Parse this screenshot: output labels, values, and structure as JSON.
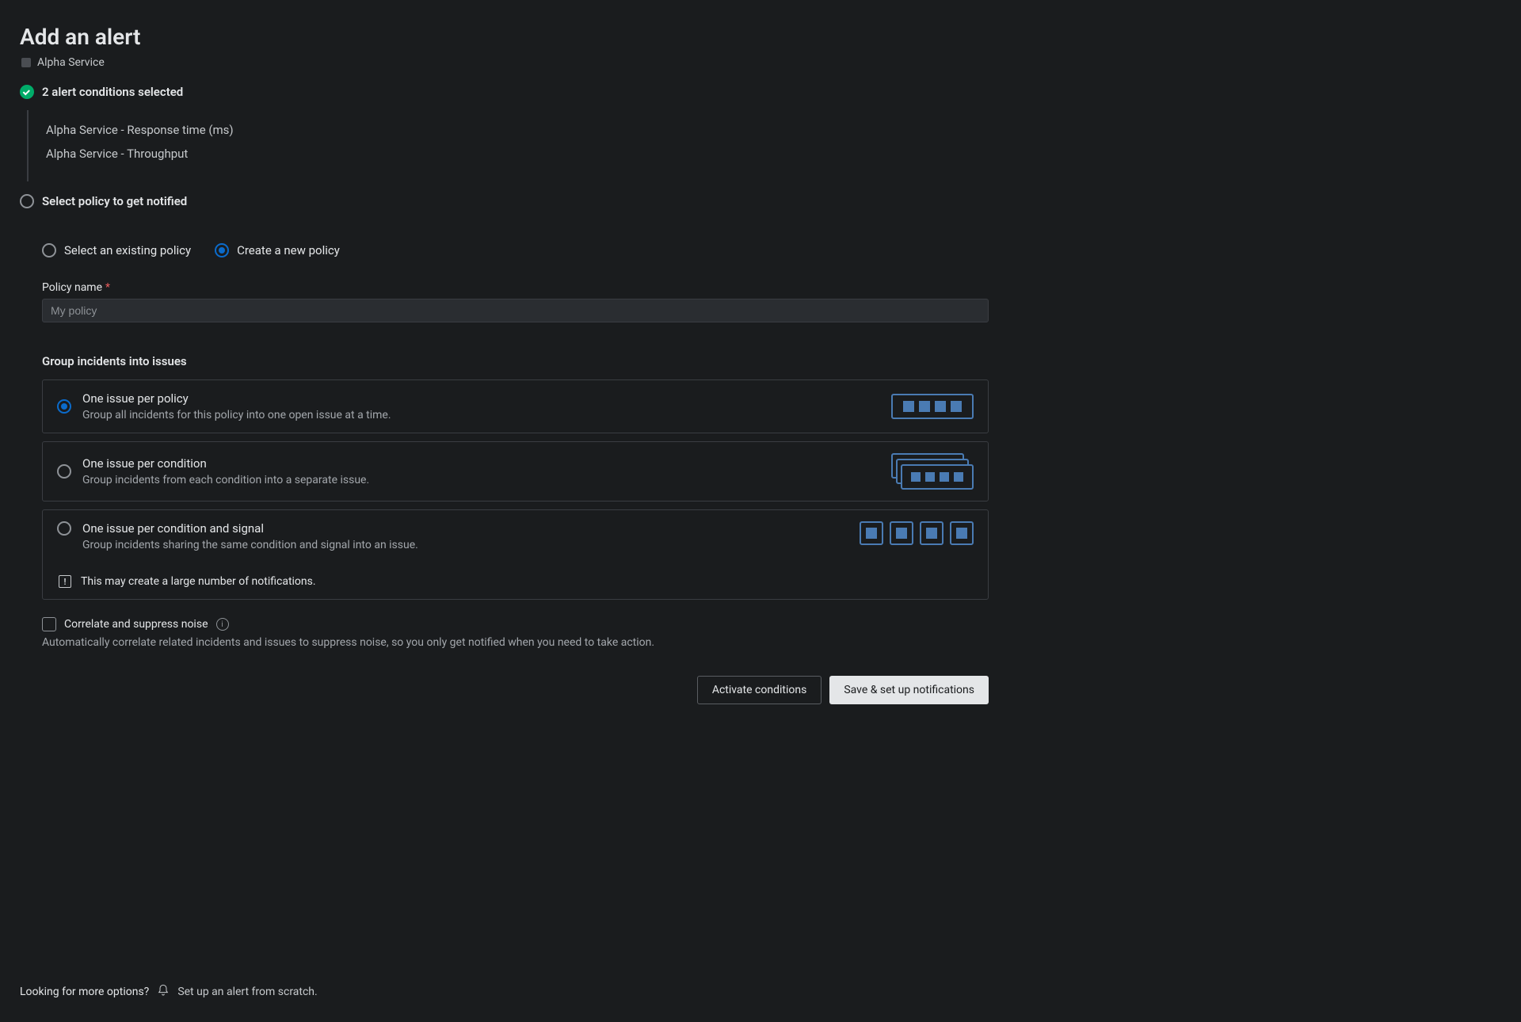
{
  "page": {
    "title": "Add an alert",
    "service": "Alpha Service"
  },
  "steps": {
    "conditions": {
      "label": "2 alert conditions selected",
      "items": [
        "Alpha Service - Response time (ms)",
        "Alpha Service - Throughput"
      ]
    },
    "policy": {
      "label": "Select policy to get notified"
    }
  },
  "policy_form": {
    "mode_options": {
      "existing": "Select an existing policy",
      "create": "Create a new policy",
      "selected": "create"
    },
    "name_label": "Policy name",
    "name_placeholder": "My policy",
    "name_value": ""
  },
  "grouping": {
    "heading": "Group incidents into issues",
    "options": [
      {
        "title": "One issue per policy",
        "desc": "Group all incidents for this policy into one open issue at a time."
      },
      {
        "title": "One issue per condition",
        "desc": "Group incidents from each condition into a separate issue."
      },
      {
        "title": "One issue per condition and signal",
        "desc": "Group incidents sharing the same condition and signal into an issue.",
        "warning": "This may create a large number of notifications."
      }
    ],
    "selected": 0
  },
  "correlate": {
    "label": "Correlate and suppress noise",
    "desc": "Automatically correlate related incidents and issues to suppress noise, so you only get notified when you need to take action.",
    "checked": false
  },
  "buttons": {
    "activate": "Activate conditions",
    "save": "Save & set up notifications"
  },
  "footer": {
    "prompt": "Looking for more options?",
    "link": "Set up an alert from scratch."
  }
}
